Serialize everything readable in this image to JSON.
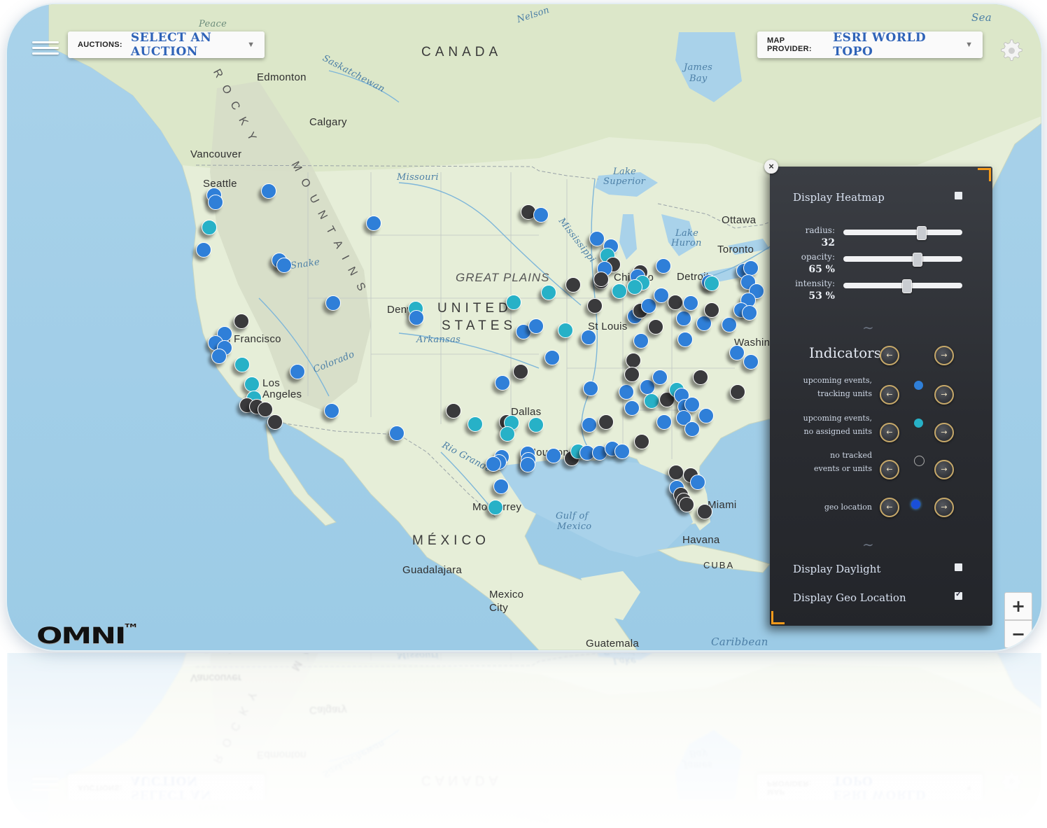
{
  "toolbar": {
    "auctions_label": "AUCTIONS:",
    "auction_value": "SELECT AN AUCTION",
    "provider_label": "MAP PROVIDER:",
    "provider_value": "ESRI WORLD TOPO"
  },
  "map_labels": {
    "canada": "CANADA",
    "united": "UNITED",
    "states": "STATES",
    "mexico": "MÉXICO",
    "great_plains": "GREAT PLAINS",
    "rocky": "ROCKY",
    "mountains": "MOUNTAINS",
    "edmonton": "Edmonton",
    "calgary": "Calgary",
    "vancouver": "Vancouver",
    "seattle": "Seattle",
    "san_francisco": "San Francisco",
    "los": "Los",
    "angeles": "Angeles",
    "denver": "Denver",
    "dallas": "Dallas",
    "houston": "Houston",
    "monterrey": "Monterrey",
    "st_louis": "St Louis",
    "chicago": "Chicago",
    "detroit": "Detroit",
    "toronto": "Toronto",
    "ottawa": "Ottawa",
    "washington": "Washington",
    "miami": "Miami",
    "havana": "Havana",
    "cuba": "CUBA",
    "guadalajara": "Guadalajara",
    "mexico_city_1": "Mexico",
    "mexico_city_2": "City",
    "guatemala": "Guatemala",
    "missouri": "Missouri",
    "colorado": "Colorado",
    "arkansas": "Arkansas",
    "rio_grande": "Rio Grande",
    "lake_superior_1": "Lake",
    "lake_superior_2": "Superior",
    "lake_huron_1": "Lake",
    "lake_huron_2": "Huron",
    "gulf_1": "Gulf of",
    "gulf_2": "Mexico",
    "caribbean": "Caribbean",
    "james_bay_1": "James",
    "james_bay_2": "Bay",
    "nelson": "Nelson",
    "peace": "Peace",
    "saskatchewan": "Saskatchewan",
    "snake": "Snake",
    "mississippi": "Mississippi",
    "sea": "Sea"
  },
  "panel": {
    "display_heatmap": "Display Heatmap",
    "heatmap_checked": false,
    "radius_label": "radius:",
    "radius_value": "32",
    "radius_level": 0.65,
    "opacity_label": "opacity:",
    "opacity_value": "65 %",
    "opacity_level": 0.62,
    "intensity_label": "intensity:",
    "intensity_value": "53 %",
    "intensity_level": 0.53,
    "indicators_title": "Indicators",
    "indicators": [
      {
        "line1": "upcoming events,",
        "line2": "tracking units",
        "color": "#2f7fd8"
      },
      {
        "line1": "upcoming events,",
        "line2": "no assigned units",
        "color": "#27b1c7"
      },
      {
        "line1": "no tracked",
        "line2": "events or units",
        "color": "#3a3a3c"
      },
      {
        "line1": "",
        "line2": "geo location",
        "color": "#1a4fd8"
      }
    ],
    "display_daylight": "Display Daylight",
    "daylight_checked": false,
    "display_geo": "Display Geo Location",
    "geo_checked": true
  },
  "zoom": {
    "in": "+",
    "out": "−"
  },
  "logo": "OMNI",
  "logo_tm": "TM",
  "colors": {
    "blue": "#2f7fd8",
    "cyan": "#27b1c7",
    "dark": "#3a3a3c",
    "accent": "#f39a1b",
    "auction_text": "#2f63b8"
  }
}
